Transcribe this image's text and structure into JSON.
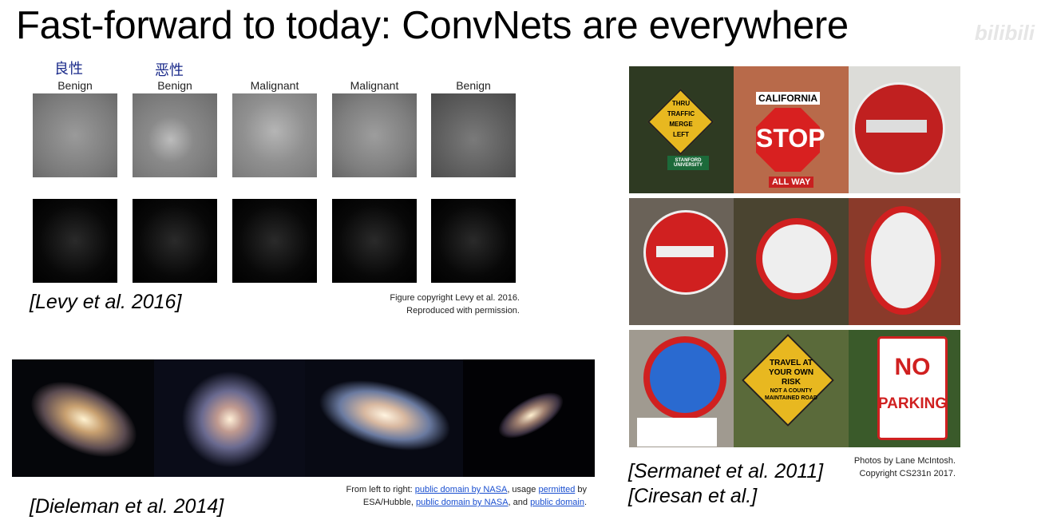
{
  "title": "Fast-forward to today: ConvNets are everywhere",
  "watermark": "bilibili",
  "handwritten": [
    "良性",
    "恶性"
  ],
  "levy": {
    "labels": [
      "Benign",
      "Benign",
      "Malignant",
      "Malignant",
      "Benign"
    ],
    "citation": "[Levy et al. 2016]",
    "copyright_line1": "Figure copyright Levy et al. 2016.",
    "copyright_line2": "Reproduced with permission."
  },
  "dieleman": {
    "citation": "[Dieleman et al. 2014]",
    "credit": {
      "prefix": "From left to right: ",
      "link1": "public domain by NASA",
      "mid1": ", usage ",
      "link2": "permitted",
      "mid2": " by ESA/Hubble, ",
      "link3": "public domain by NASA",
      "mid3": ", and ",
      "link4": "public domain",
      "suffix": "."
    }
  },
  "signs": {
    "texts": {
      "merge": "THRU TRAFFIC MERGE LEFT",
      "stanford": "STANFORD UNIVERSITY",
      "california": "CALIFORNIA",
      "stop": "STOP",
      "allway": "ALL WAY",
      "travel": "TRAVEL AT YOUR OWN RISK",
      "county": "NOT A COUNTY MAINTAINED ROAD",
      "no": "NO",
      "parking": "PARKING"
    },
    "citation1": "[Sermanet et al. 2011]",
    "citation2": "[Ciresan et al.]",
    "credit_line1": "Photos by Lane McIntosh.",
    "credit_line2": "Copyright CS231n 2017."
  }
}
